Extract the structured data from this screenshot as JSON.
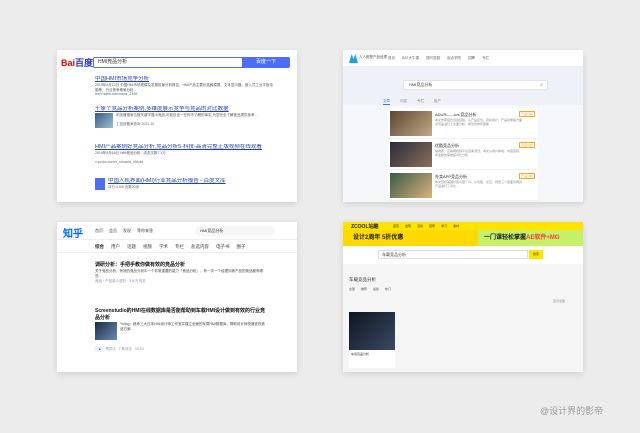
{
  "baidu": {
    "logo_a": "Bai",
    "logo_b": "百度",
    "query": "HMI竞品分析",
    "search_button": "百度一下",
    "results": [
      {
        "title_hl": "中国HMI市场竞争分析",
        "desc": "2019年4月10日 中国HMI市场规模及发展前景分析报告，HMI产品主要包括触摸屏、文本显示器、嵌入式工业平板电脑等，行业竞争格局分析...",
        "url": "tech.hqew.com/news_2309"
      },
      {
        "title_hl": "千象个竞品分析案例,多维度展示竞争与竞品的对比数据",
        "desc": "浏览器搜索位数关键字展示竞品,可能包含一些你不了解的事实,为您完全了解竞品提供参考...",
        "url": "工信部备案查询 2021-10"
      },
      {
        "title_hl": "HMI产品案例好竞品分析,竞品分析5-科技-高清完整正版视频在线观看",
        "desc": "2019年9月18日 HMI竞品分析...浏览次数7.1万",
        "url": "v.youku.com/v_show/id_XMzkz"
      },
      {
        "title_hl": "中国人机界面(HMI)行业竞品分析报告 - 百度文库",
        "desc": "评分:4.5/5 页数20页",
        "url": ""
      }
    ]
  },
  "qidian": {
    "brand": "人人都是产品经理",
    "nav": [
      "首页",
      "BAT大牛课",
      "提问答疑",
      "起点学院",
      "招聘",
      "专栏"
    ],
    "query": "HMI竞品分析",
    "tabs": [
      "文章",
      "问答",
      "专栏",
      "用户"
    ],
    "items": [
      {
        "title": "ADUR——ios 竞品分析",
        "desc": "本文作者结合自身经验，从产品定位、目标用户、产品功能等方面对竞品进行了全面分析，希望对你有帮助...",
        "tag": "产品分析"
      },
      {
        "title": "优酷竞品分析",
        "desc": "编者按：互联网视频平台竞争激烈，本文从用户体验、内容运营、商业模式等维度对比分析...",
        "tag": "竞品分析"
      },
      {
        "title": "外卖APP竞品分析",
        "desc": "本文围绕美团外卖与饿了么，从功能、交互、视觉三个层面对两款产品进行了对比...",
        "tag": "产品分析"
      }
    ]
  },
  "zhihu": {
    "logo": "知乎",
    "nav": [
      "首页",
      "会员",
      "发现",
      "等你来答"
    ],
    "query": "HMI竞品分析",
    "tabs": [
      "综合",
      "用户",
      "话题",
      "视频",
      "学术",
      "专栏",
      "盐选内容",
      "电子书",
      "圈子"
    ],
    "answers": [
      {
        "title": "调研分析：手把手教你做有效的竞品分析",
        "desc": "关于竞品分析，有效的竞品分析中一个非常重要的能力「竞品分析」，有一次一个经理问我产品的竞品都有哪些...",
        "meta": "竞品 · 产品新人进阶 · 3.6 万浏览"
      },
      {
        "title": "Screenstudio的HMI在线数据库是否能帮助到车载HMI设计做到有效的行业竞品分析",
        "desc": "Yuling：继承三大日本HMI设计师工作室并建立全面的车载HMI数据库，帮助设计师快速查找竞品方案...",
        "meta": "赞同 8 · 2 条评论 · 09:03"
      }
    ]
  },
  "zcool": {
    "logo": "ZCOOL站酷",
    "nav": [
      "首页",
      "发现",
      "活动",
      "招聘",
      "学习",
      "素材"
    ],
    "banner_left": "设计2周年 5折优惠",
    "banner_right": "一门课轻松掌握",
    "banner_right_hl": "AE软件+MG",
    "query": "车载竞品分析",
    "search_button": "搜索",
    "section_title": "车载竞品分析",
    "filters": [
      "全部",
      "推荐",
      "最新",
      "热门"
    ],
    "toggle": "显示全部",
    "tiles": [
      {
        "title": "车载竞品分析"
      }
    ]
  },
  "credit": "@设计界的影帝"
}
